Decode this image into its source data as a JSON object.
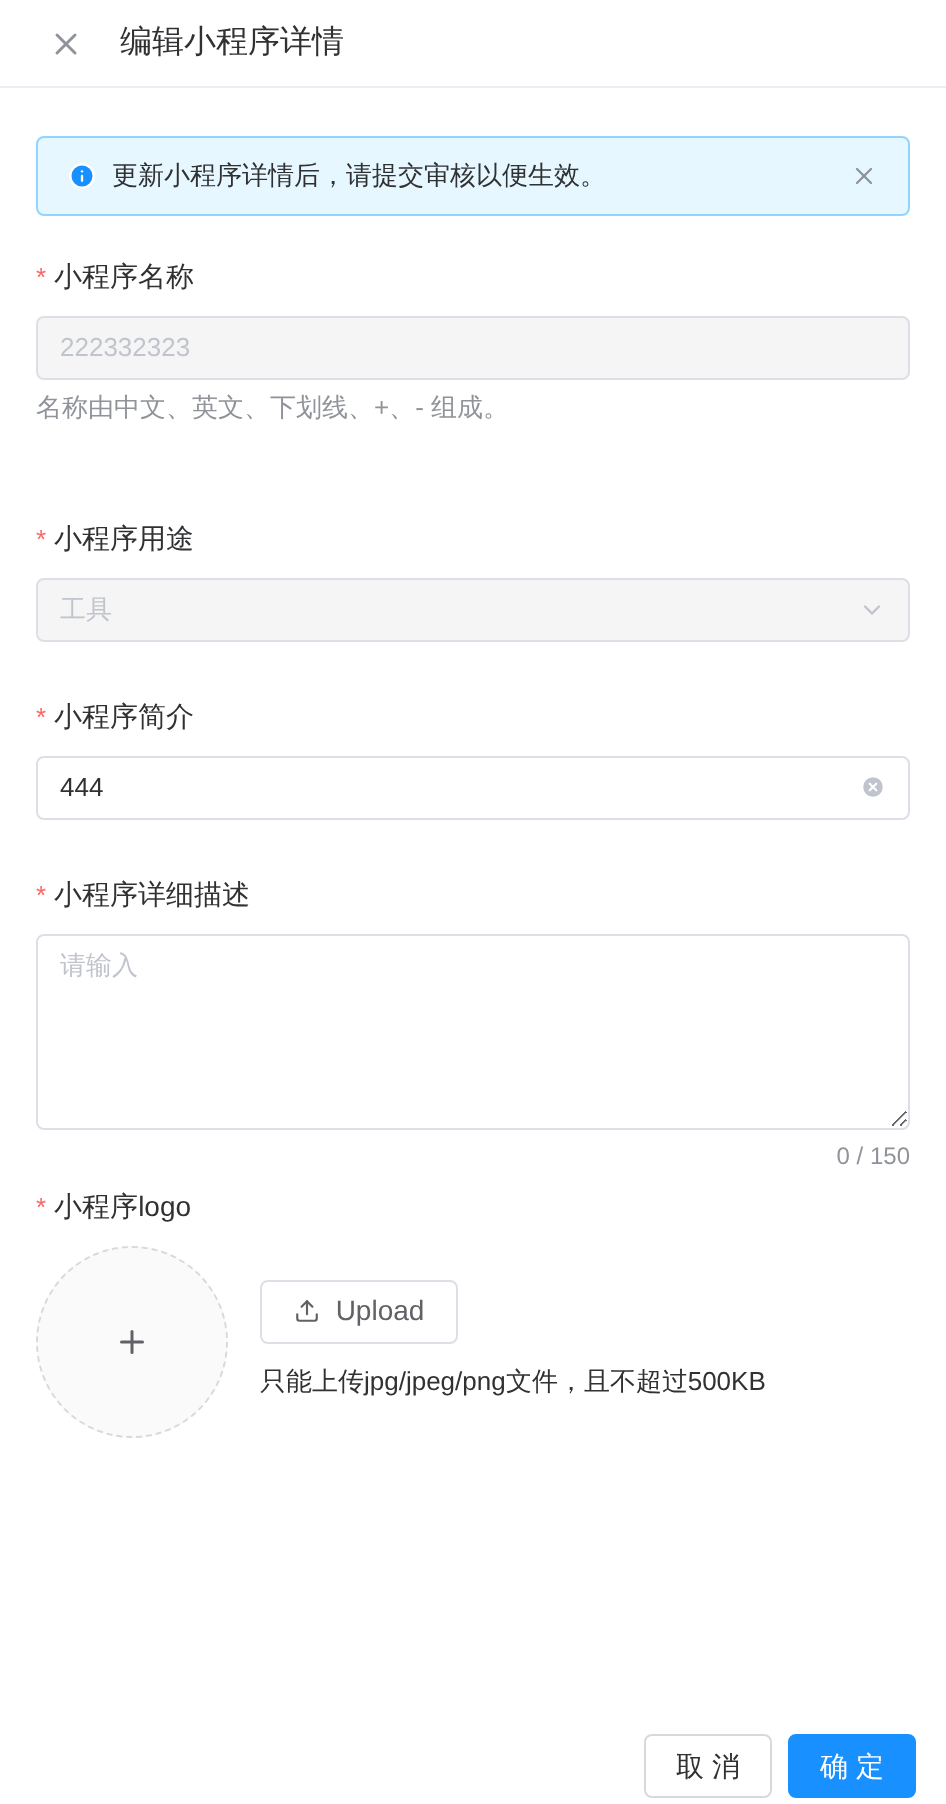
{
  "header": {
    "title": "编辑小程序详情"
  },
  "alert": {
    "message": "更新小程序详情后，请提交审核以便生效。"
  },
  "fields": [
    {
      "kind": "input",
      "label": "小程序名称",
      "required_mark": "*",
      "value": "222332323",
      "disabled": true,
      "hint": "名称由中文、英文、下划线、+、- 组成。"
    },
    {
      "kind": "select",
      "label": "小程序用途",
      "required_mark": "*",
      "value": "工具",
      "disabled": true
    },
    {
      "kind": "input",
      "label": "小程序简介",
      "required_mark": "*",
      "value": "444",
      "disabled": false,
      "clearable": true
    },
    {
      "kind": "textarea",
      "label": "小程序详细描述",
      "required_mark": "*",
      "placeholder": "请输入",
      "counter": "0 / 150"
    },
    {
      "kind": "upload",
      "label": "小程序logo",
      "required_mark": "*",
      "button": "Upload",
      "hint": "只能上传jpg/jpeg/png文件，且不超过500KB"
    }
  ],
  "footer": {
    "buttons": [
      {
        "label": "取 消",
        "primary": false
      },
      {
        "label": "确 定",
        "primary": true
      }
    ]
  }
}
